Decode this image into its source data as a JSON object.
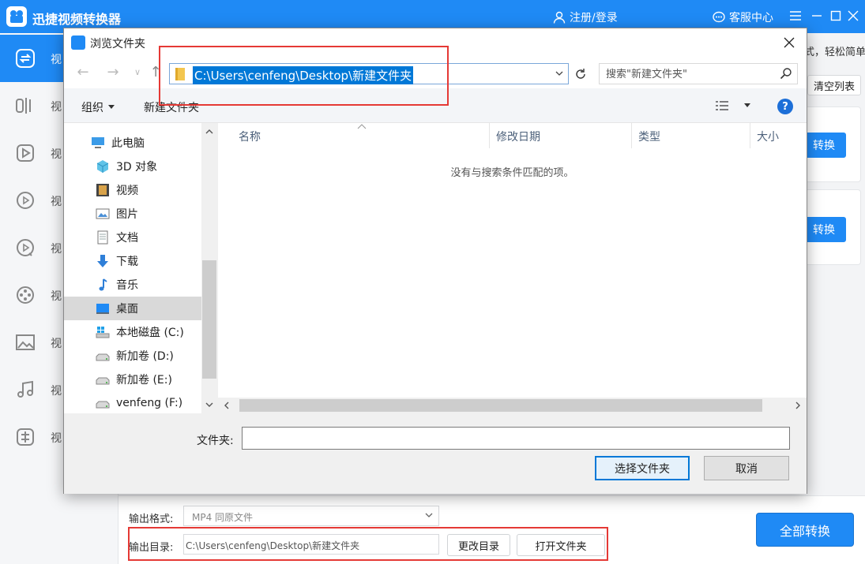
{
  "app": {
    "name": "迅捷视频转换器",
    "login": "注册/登录",
    "service": "客服中心",
    "tagline": "式，轻松简单",
    "clear_list": "清空列表",
    "card_button": "转换",
    "sidebar": [
      {
        "label": "视",
        "icon": "convert-icon"
      },
      {
        "label": "视",
        "icon": "split-icon"
      },
      {
        "label": "视",
        "icon": "play-icon"
      },
      {
        "label": "视",
        "icon": "gif-icon"
      },
      {
        "label": "视",
        "icon": "compress-icon"
      },
      {
        "label": "视",
        "icon": "film-icon"
      },
      {
        "label": "视",
        "icon": "image-icon"
      },
      {
        "label": "视",
        "icon": "music-icon"
      },
      {
        "label": "视",
        "icon": "merge-icon"
      }
    ],
    "output": {
      "format_label": "输出格式:",
      "format_value": "MP4   同原文件",
      "dir_label": "输出目录:",
      "dir_value": "C:\\Users\\cenfeng\\Desktop\\新建文件夹",
      "change_dir": "更改目录",
      "open_folder": "打开文件夹",
      "convert_all": "全部转换"
    }
  },
  "dialog": {
    "title": "浏览文件夹",
    "address": "C:\\Users\\cenfeng\\Desktop\\新建文件夹",
    "search_placeholder": "搜索\"新建文件夹\"",
    "organize": "组织",
    "new_folder": "新建文件夹",
    "columns": [
      "名称",
      "修改日期",
      "类型",
      "大小"
    ],
    "empty_message": "没有与搜索条件匹配的项。",
    "tree": [
      {
        "label": "此电脑",
        "icon": "computer-icon"
      },
      {
        "label": "3D 对象",
        "icon": "cube-icon"
      },
      {
        "label": "视频",
        "icon": "video-icon"
      },
      {
        "label": "图片",
        "icon": "picture-icon"
      },
      {
        "label": "文档",
        "icon": "document-icon"
      },
      {
        "label": "下载",
        "icon": "download-icon"
      },
      {
        "label": "音乐",
        "icon": "music-note-icon"
      },
      {
        "label": "桌面",
        "icon": "desktop-icon",
        "selected": true
      },
      {
        "label": "本地磁盘 (C:)",
        "icon": "windows-drive-icon"
      },
      {
        "label": "新加卷 (D:)",
        "icon": "drive-icon"
      },
      {
        "label": "新加卷 (E:)",
        "icon": "drive-icon"
      },
      {
        "label": "venfeng (F:)",
        "icon": "drive-icon"
      }
    ],
    "folder_label": "文件夹:",
    "folder_value": "",
    "select_button": "选择文件夹",
    "cancel_button": "取消"
  },
  "colors": {
    "accent": "#1f8af5",
    "highlight": "#0078d7",
    "annotation": "#e53935"
  }
}
